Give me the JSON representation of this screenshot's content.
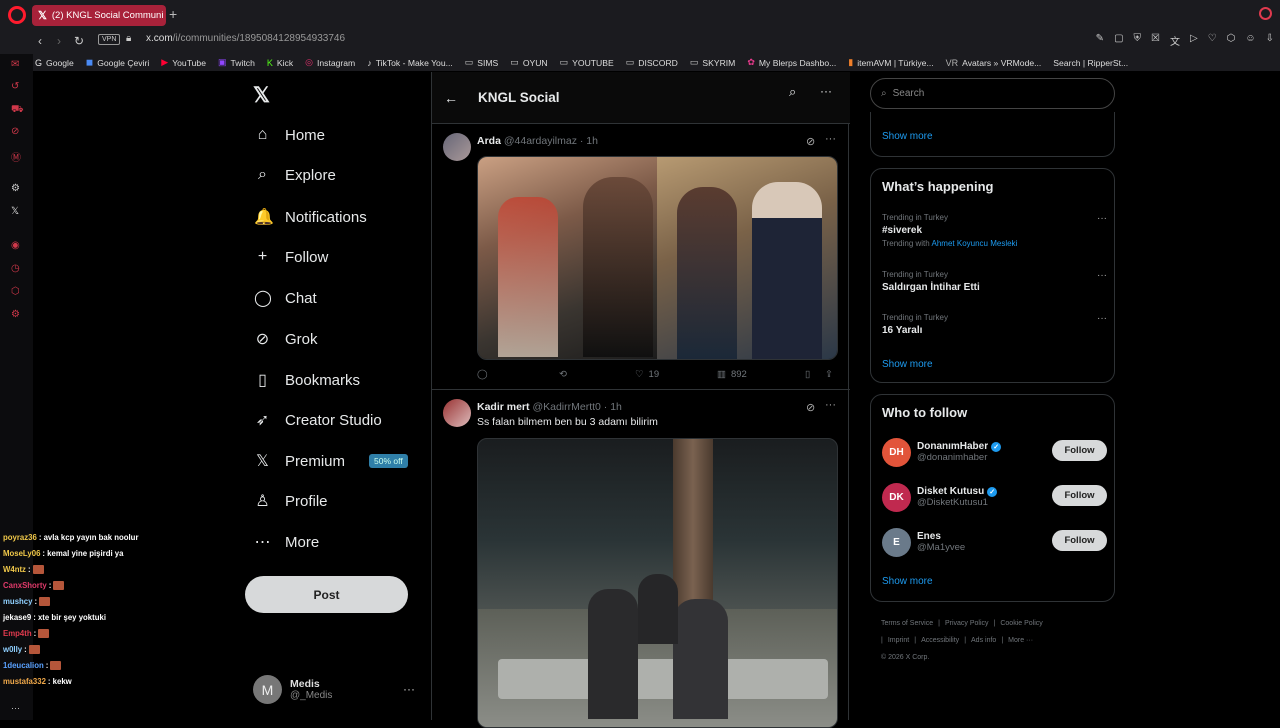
{
  "browser": {
    "tab_title": "(2) KNGL Social Communi",
    "new_tab": "+",
    "vpn": "VPN",
    "url_host": "x.com",
    "url_path": "/i/communities/1895084128954933746",
    "bookmarks": [
      {
        "icon": "G",
        "label": "Google",
        "color": "#e8e8e8"
      },
      {
        "icon": "◼",
        "label": "Google Çeviri",
        "color": "#4a8af4"
      },
      {
        "icon": "▶",
        "label": "YouTube",
        "color": "#ff0033"
      },
      {
        "icon": "▣",
        "label": "Twitch",
        "color": "#9146ff"
      },
      {
        "icon": "K",
        "label": "Kick",
        "color": "#53fc18"
      },
      {
        "icon": "◎",
        "label": "Instagram",
        "color": "#e1306c"
      },
      {
        "icon": "♪",
        "label": "TikTok - Make You...",
        "color": "#dddddd"
      },
      {
        "icon": "▭",
        "label": "SIMS",
        "color": "#cccccc"
      },
      {
        "icon": "▭",
        "label": "OYUN",
        "color": "#cccccc"
      },
      {
        "icon": "▭",
        "label": "YOUTUBE",
        "color": "#cccccc"
      },
      {
        "icon": "▭",
        "label": "DISCORD",
        "color": "#cccccc"
      },
      {
        "icon": "▭",
        "label": "SKYRIM",
        "color": "#cccccc"
      },
      {
        "icon": "✿",
        "label": "My Blerps Dashbo...",
        "color": "#e5398b"
      },
      {
        "icon": "▮",
        "label": "itemAVM | Türkiye...",
        "color": "#f07f2a"
      },
      {
        "icon": "VR",
        "label": "Avatars » VRMode...",
        "color": "#b0b0b0"
      },
      {
        "icon": "",
        "label": "Search | RipperSt...",
        "color": "#cccccc"
      }
    ]
  },
  "nav": {
    "items": [
      {
        "icon": "⌂",
        "label": "Home"
      },
      {
        "icon": "⌕",
        "label": "Explore"
      },
      {
        "icon": "🔔",
        "label": "Notifications"
      },
      {
        "icon": "+",
        "label": "Follow"
      },
      {
        "icon": "◯",
        "label": "Chat"
      },
      {
        "icon": "⊘",
        "label": "Grok"
      },
      {
        "icon": "▯",
        "label": "Bookmarks"
      },
      {
        "icon": "➶",
        "label": "Creator Studio"
      },
      {
        "icon": "𝕏",
        "label": "Premium"
      },
      {
        "icon": "♙",
        "label": "Profile"
      },
      {
        "icon": "⋯",
        "label": "More"
      }
    ],
    "premium_badge": "50% off",
    "post_button": "Post",
    "profile_initial": "M",
    "profile_name": "Medis",
    "profile_handle": "@_Medis"
  },
  "chat": [
    {
      "user": "poyraz36",
      "color": "#f1c94a",
      "msg": ": avla kcp yayın bak noolur",
      "emote": false
    },
    {
      "user": "MoseLy06",
      "color": "#f1c94a",
      "msg": ": kemal yine pişirdi ya",
      "emote": false
    },
    {
      "user": "W4ntz",
      "color": "#f1c94a",
      "msg": ":",
      "emote": true
    },
    {
      "user": "CanxShorty",
      "color": "#e03a6a",
      "msg": ":",
      "emote": true
    },
    {
      "user": "mushcy",
      "color": "#8fd0ff",
      "msg": ":",
      "emote": true
    },
    {
      "user": "jekase9",
      "color": "#ffffff",
      "msg": ": xte bir şey yoktuki",
      "emote": false
    },
    {
      "user": "Emp4th",
      "color": "#e03a4e",
      "msg": ":",
      "emote": true
    },
    {
      "user": "w0lly",
      "color": "#8fd0ff",
      "msg": ":",
      "emote": true
    },
    {
      "user": "1deucalion",
      "color": "#5aa2ff",
      "msg": ":",
      "emote": true
    },
    {
      "user": "mustafa332",
      "color": "#f1a94a",
      "msg": ": kekw",
      "emote": false
    }
  ],
  "timeline": {
    "title": "KNGL Social",
    "tweets": [
      {
        "name": "Arda",
        "handle": "@44ardayilmaz · 1h",
        "text": "",
        "replies": "",
        "reposts": "",
        "likes": "19",
        "views": "892"
      },
      {
        "name": "Kadir mert",
        "handle": "@KadirrMertt0 · 1h",
        "text": "Ss falan bilmem ben bu 3 adamı bilirim"
      }
    ]
  },
  "right": {
    "search_placeholder": "Search",
    "show_more": "Show more",
    "whats_happening": "What’s happening",
    "trends": [
      {
        "category": "Trending in Turkey",
        "name": "#siverek",
        "with_label": "Trending with",
        "with_link": "Ahmet Koyuncu Mesleki"
      },
      {
        "category": "Trending in Turkey",
        "name": "Saldırgan İntihar Etti",
        "with_label": "",
        "with_link": ""
      },
      {
        "category": "Trending in Turkey",
        "name": "16 Yaralı",
        "with_label": "",
        "with_link": ""
      }
    ],
    "who_to_follow": "Who to follow",
    "follow_label": "Follow",
    "suggestions": [
      {
        "initials": "DH",
        "bg": "#e2543a",
        "name": "DonanımHaber",
        "verified": true,
        "handle": "@donanimhaber"
      },
      {
        "initials": "DK",
        "bg": "#c0294f",
        "name": "Disket Kutusu",
        "verified": true,
        "handle": "@DisketKutusu1"
      },
      {
        "initials": "E",
        "bg": "#6a7a8a",
        "name": "Enes",
        "verified": false,
        "handle": "@Ma1yvee"
      }
    ],
    "footer": [
      "Terms of Service",
      "|",
      "Privacy Policy",
      "|",
      "Cookie Policy",
      "|",
      "Imprint",
      "|",
      "Accessibility",
      "|",
      "Ads info",
      "|",
      "More ···",
      "© 2026 X Corp."
    ]
  }
}
